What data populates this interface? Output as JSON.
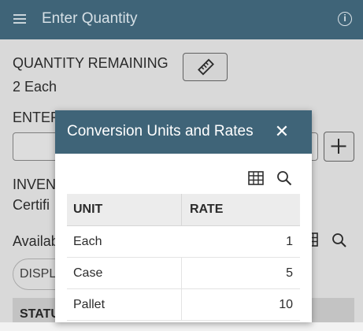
{
  "header": {
    "title": "Enter Quantity"
  },
  "page": {
    "quantity_remaining_label": "QUANTITY REMAINING",
    "quantity_remaining_value": "2 Each",
    "enter_label": "ENTER",
    "inventory_label": "INVEN",
    "certified_text": "Certifi",
    "available_text": "Availab",
    "display_pill": "DISPL",
    "status_header": "STATU"
  },
  "modal": {
    "title": "Conversion Units and Rates",
    "columns": {
      "unit": "UNIT",
      "rate": "RATE"
    },
    "rows": [
      {
        "unit": "Each",
        "rate": "1"
      },
      {
        "unit": "Case",
        "rate": "5"
      },
      {
        "unit": "Pallet",
        "rate": "10"
      }
    ]
  },
  "icons": {
    "menu": "hamburger-icon",
    "info": "info-icon",
    "ruler": "ruler-icon",
    "plus": "plus-icon",
    "close": "close-icon",
    "grid": "grid-icon",
    "search": "search-icon"
  },
  "colors": {
    "header_bg": "#3f6478"
  }
}
